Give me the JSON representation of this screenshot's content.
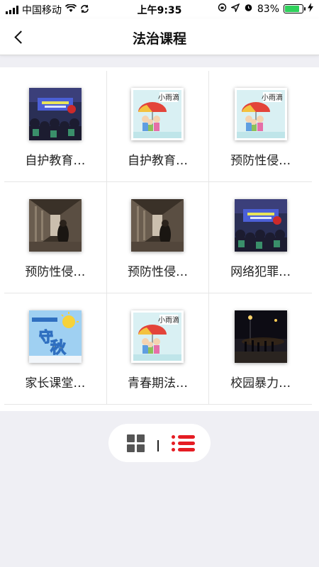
{
  "status_bar": {
    "carrier": "中国移动",
    "time": "上午9:35",
    "battery": "83%",
    "battery_level": 0.83,
    "icons": [
      "signal-icon",
      "wifi-icon",
      "sync-icon",
      "rotation-lock-icon",
      "location-icon",
      "alarm-icon",
      "battery-icon",
      "charging-icon"
    ]
  },
  "nav": {
    "title": "法治课程",
    "back_icon": "back-arrow-icon"
  },
  "courses": [
    {
      "label": "自护教育…",
      "thumb": "event-photo"
    },
    {
      "label": "自护教育…",
      "thumb": "book-cover"
    },
    {
      "label": "预防性侵…",
      "thumb": "book-cover"
    },
    {
      "label": "预防性侵…",
      "thumb": "hallway-photo"
    },
    {
      "label": "预防性侵…",
      "thumb": "hallway-photo"
    },
    {
      "label": "网络犯罪…",
      "thumb": "event-photo"
    },
    {
      "label": "家长课堂…",
      "thumb": "poster"
    },
    {
      "label": "青春期法…",
      "thumb": "book-cover"
    },
    {
      "label": "校园暴力…",
      "thumb": "night-photo"
    }
  ],
  "view_toggle": {
    "separator": "|",
    "active": "list",
    "accent_color": "#e51c23"
  }
}
